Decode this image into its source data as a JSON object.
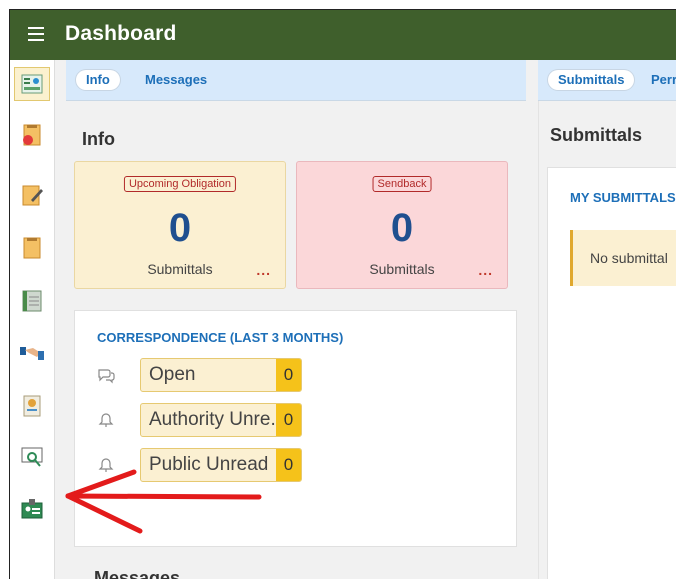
{
  "app": {
    "title": "Dashboard"
  },
  "left_tabs": [
    {
      "label": "Info",
      "selected": true
    },
    {
      "label": "Messages",
      "selected": false
    }
  ],
  "right_tabs": [
    {
      "label": "Submittals",
      "selected": true
    },
    {
      "label": "Perr",
      "selected": false
    }
  ],
  "info": {
    "heading": "Info",
    "cards": [
      {
        "badge": "Upcoming Obligation",
        "count": "0",
        "label": "Submittals",
        "more": "..."
      },
      {
        "badge": "Sendback",
        "count": "0",
        "label": "Submittals",
        "more": "..."
      }
    ]
  },
  "correspondence": {
    "title": "CORRESPONDENCE (LAST 3 MONTHS)",
    "rows": [
      {
        "label": "Open",
        "count": "0",
        "icon": "chat-icon"
      },
      {
        "label": "Authority Unre...",
        "count": "0",
        "icon": "bell-icon"
      },
      {
        "label": "Public Unread",
        "count": "0",
        "icon": "bell-icon"
      }
    ]
  },
  "messages": {
    "heading": "Messages"
  },
  "submittals": {
    "heading": "Submittals",
    "section_title": "MY SUBMITTALS",
    "empty_text": "No submittal"
  },
  "rail_icons": [
    "dashboard-icon",
    "document-icon",
    "edit-document-icon",
    "document-icon",
    "ledger-icon",
    "handshake-icon",
    "certificate-icon",
    "inspection-icon",
    "id-card-icon"
  ],
  "colors": {
    "topbar": "#3f5f2c",
    "accent": "#1d6fb8",
    "arrow": "#e31b1b",
    "count_badge": "#f5c21a"
  }
}
